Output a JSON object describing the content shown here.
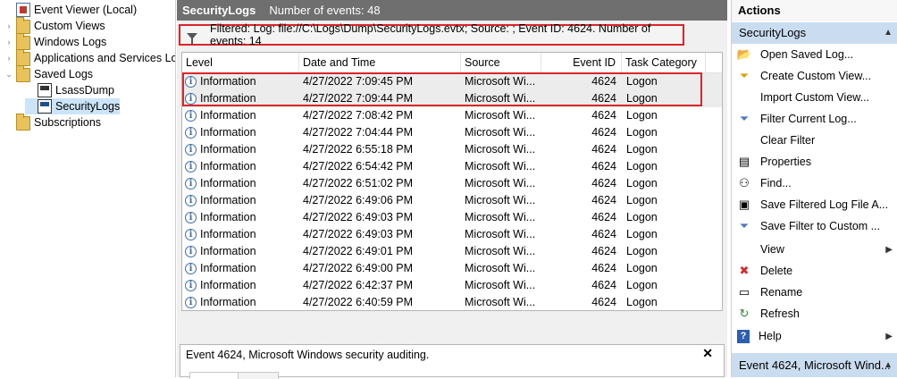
{
  "tree": {
    "items": [
      {
        "label": "Event Viewer (Local)",
        "exp": "",
        "icon": "event-viewer-icon"
      },
      {
        "label": "Custom Views",
        "exp": "›",
        "icon": "folder-icon"
      },
      {
        "label": "Windows Logs",
        "exp": "›",
        "icon": "folder-icon"
      },
      {
        "label": "Applications and Services Lo",
        "exp": "›",
        "icon": "folder-icon"
      },
      {
        "label": "Saved Logs",
        "exp": "⌄",
        "icon": "folder-icon"
      },
      {
        "label": "LsassDump",
        "exp": "",
        "icon": "saved-log-icon"
      },
      {
        "label": "SecurityLogs",
        "exp": "",
        "icon": "saved-log-icon"
      },
      {
        "label": "Subscriptions",
        "exp": "",
        "icon": "subscriptions-icon"
      }
    ]
  },
  "center": {
    "title": "SecurityLogs",
    "event_count": "Number of events: 48",
    "filter_text": "Filtered: Log: file://C:\\Logs\\Dump\\SecurityLogs.evtx; Source: ; Event ID: 4624. Number of events: 14",
    "columns": [
      "Level",
      "Date and Time",
      "Source",
      "Event ID",
      "Task Category"
    ],
    "rows": [
      [
        "Information",
        "4/27/2022 7:09:45 PM",
        "Microsoft Wi...",
        "4624",
        "Logon"
      ],
      [
        "Information",
        "4/27/2022 7:09:44 PM",
        "Microsoft Wi...",
        "4624",
        "Logon"
      ],
      [
        "Information",
        "4/27/2022 7:08:42 PM",
        "Microsoft Wi...",
        "4624",
        "Logon"
      ],
      [
        "Information",
        "4/27/2022 7:04:44 PM",
        "Microsoft Wi...",
        "4624",
        "Logon"
      ],
      [
        "Information",
        "4/27/2022 6:55:18 PM",
        "Microsoft Wi...",
        "4624",
        "Logon"
      ],
      [
        "Information",
        "4/27/2022 6:54:42 PM",
        "Microsoft Wi...",
        "4624",
        "Logon"
      ],
      [
        "Information",
        "4/27/2022 6:51:02 PM",
        "Microsoft Wi...",
        "4624",
        "Logon"
      ],
      [
        "Information",
        "4/27/2022 6:49:06 PM",
        "Microsoft Wi...",
        "4624",
        "Logon"
      ],
      [
        "Information",
        "4/27/2022 6:49:03 PM",
        "Microsoft Wi...",
        "4624",
        "Logon"
      ],
      [
        "Information",
        "4/27/2022 6:49:03 PM",
        "Microsoft Wi...",
        "4624",
        "Logon"
      ],
      [
        "Information",
        "4/27/2022 6:49:01 PM",
        "Microsoft Wi...",
        "4624",
        "Logon"
      ],
      [
        "Information",
        "4/27/2022 6:49:00 PM",
        "Microsoft Wi...",
        "4624",
        "Logon"
      ],
      [
        "Information",
        "4/27/2022 6:42:37 PM",
        "Microsoft Wi...",
        "4624",
        "Logon"
      ],
      [
        "Information",
        "4/27/2022 6:40:59 PM",
        "Microsoft Wi...",
        "4624",
        "Logon"
      ]
    ],
    "detail_title": "Event 4624, Microsoft Windows security auditing.",
    "detail_close": "✕"
  },
  "actions": {
    "title": "Actions",
    "group1": "SecurityLogs",
    "items": [
      {
        "label": "Open Saved Log...",
        "icon": "open-folder-icon",
        "glyph": "📂",
        "arrow": false
      },
      {
        "label": "Create Custom View...",
        "icon": "create-filter-icon",
        "glyph": "⏷",
        "arrow": false
      },
      {
        "label": "Import Custom View...",
        "icon": "",
        "glyph": "",
        "arrow": false
      },
      {
        "label": "Filter Current Log...",
        "icon": "filter-icon",
        "glyph": "⏷",
        "arrow": false
      },
      {
        "label": "Clear Filter",
        "icon": "",
        "glyph": "",
        "arrow": false
      },
      {
        "label": "Properties",
        "icon": "properties-icon",
        "glyph": "▤",
        "arrow": false
      },
      {
        "label": "Find...",
        "icon": "binoculars-icon",
        "glyph": "⚇",
        "arrow": false
      },
      {
        "label": "Save Filtered Log File A...",
        "icon": "save-icon",
        "glyph": "▣",
        "arrow": false
      },
      {
        "label": "Save Filter to Custom ...",
        "icon": "save-filter-icon",
        "glyph": "⏷",
        "arrow": false
      },
      {
        "label": "View",
        "icon": "",
        "glyph": "",
        "arrow": true
      },
      {
        "label": "Delete",
        "icon": "delete-icon",
        "glyph": "✖",
        "arrow": false
      },
      {
        "label": "Rename",
        "icon": "rename-icon",
        "glyph": "▭",
        "arrow": false
      },
      {
        "label": "Refresh",
        "icon": "refresh-icon",
        "glyph": "↻",
        "arrow": false
      },
      {
        "label": "Help",
        "icon": "help-icon",
        "glyph": "?",
        "arrow": true
      }
    ],
    "group2": "Event 4624, Microsoft Wind..."
  },
  "colors": {
    "title_bar": "#6f6f6f",
    "highlight_red": "#d9262b",
    "group_header": "#c9dcf0",
    "selection": "#cce4f7"
  }
}
